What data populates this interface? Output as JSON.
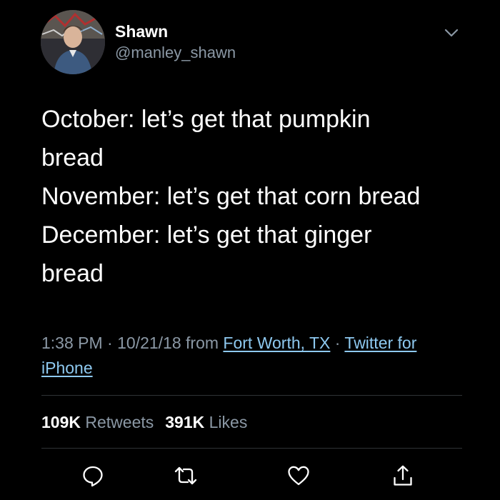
{
  "author": {
    "display_name": "Shawn",
    "handle": "@manley_shawn"
  },
  "tweet": {
    "lines": [
      "October: let’s get that pumpkin",
      "bread",
      "November: let’s get that corn bread",
      "December: let’s get that ginger",
      "bread"
    ]
  },
  "meta": {
    "time": "1:38 PM",
    "sep1": " · ",
    "date": "10/21/18",
    "from_label": " from ",
    "location": "Fort Worth, TX",
    "sep2": " · ",
    "source": "Twitter for iPhone"
  },
  "stats": {
    "retweets_count": "109K",
    "retweets_label": "Retweets",
    "likes_count": "391K",
    "likes_label": "Likes"
  },
  "icons": {
    "caret": "chevron-down-icon",
    "reply": "reply-icon",
    "retweet": "retweet-icon",
    "like": "heart-icon",
    "share": "share-icon"
  },
  "colors": {
    "background": "#000000",
    "primary_text": "#ffffff",
    "secondary_text": "#8b98a5",
    "link": "#8ec9f0",
    "divider": "#2f3336"
  }
}
